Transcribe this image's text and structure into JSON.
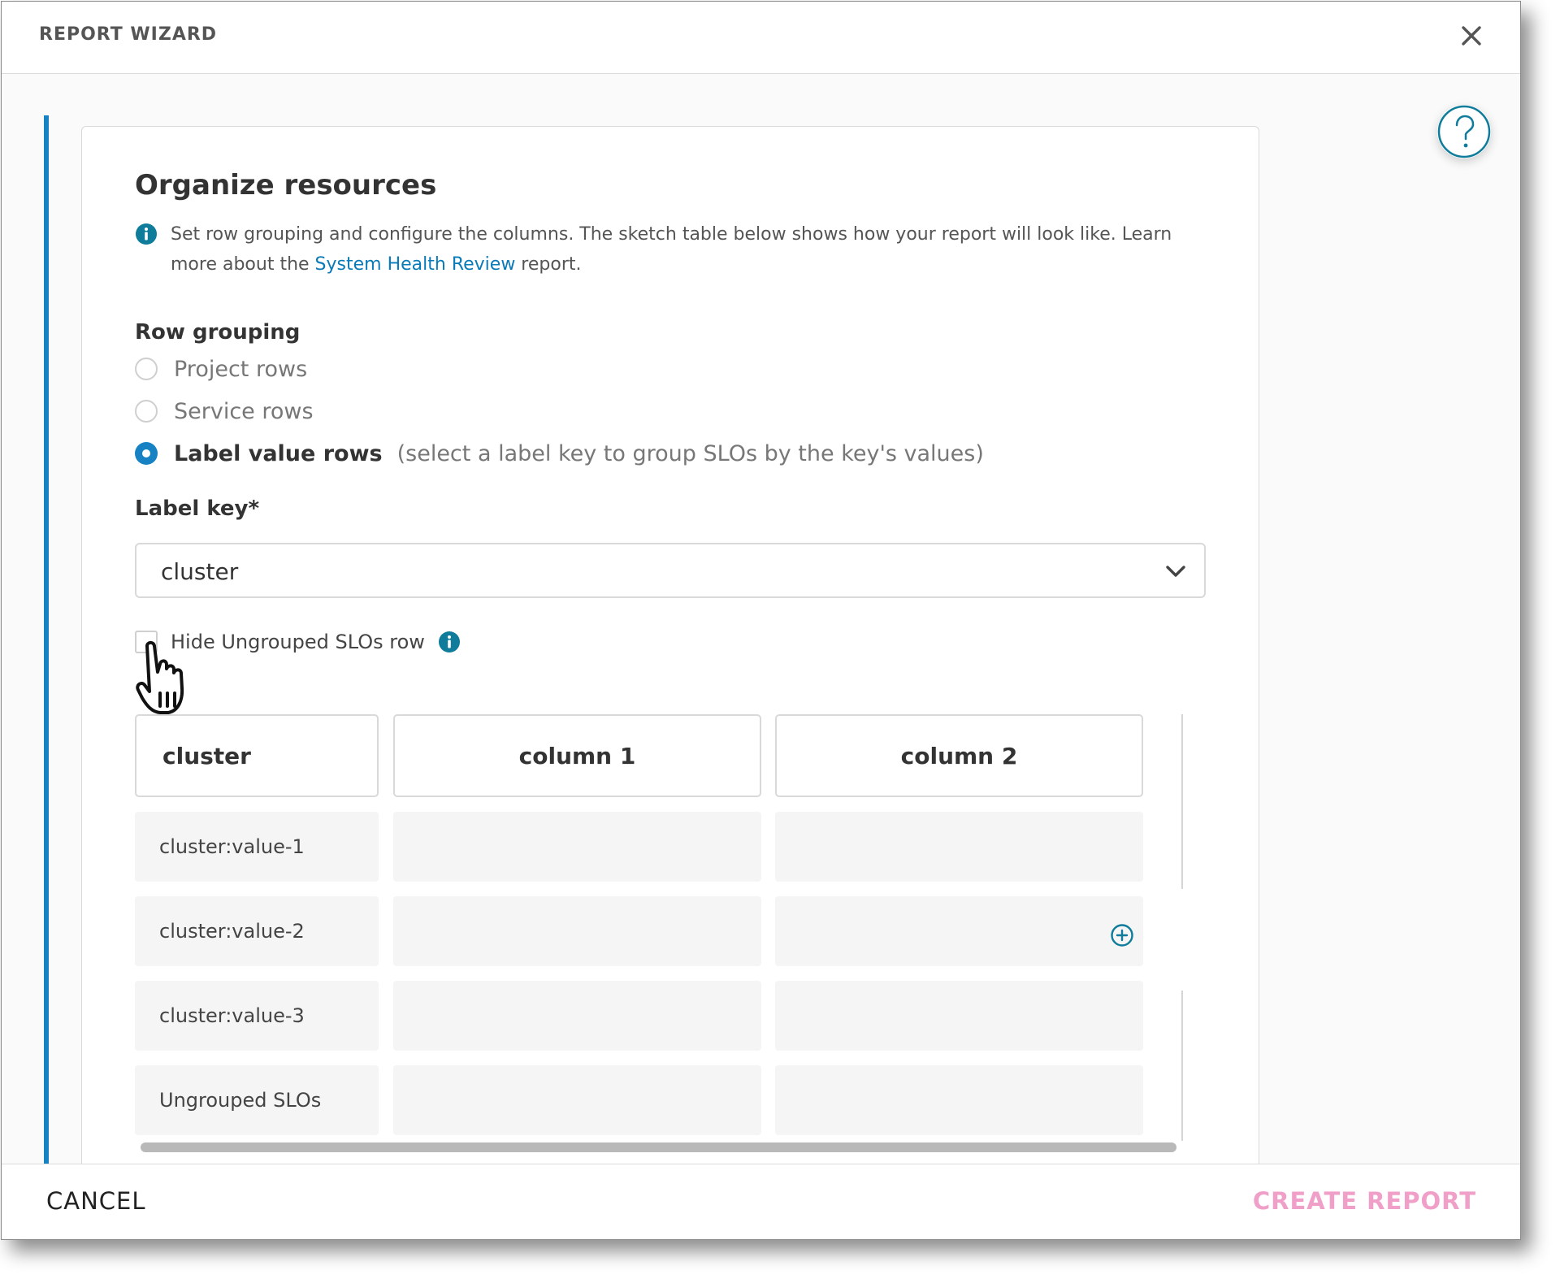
{
  "header": {
    "title": "REPORT WIZARD",
    "close_icon": "close-icon"
  },
  "help": {
    "icon": "question-icon"
  },
  "section": {
    "title": "Organize resources",
    "info": {
      "icon": "info-icon",
      "text_before": "Set row grouping and configure the columns. The sketch table below shows how your report will look like. Learn more about the ",
      "link_text": "System Health Review",
      "text_after": " report."
    }
  },
  "row_grouping": {
    "label": "Row grouping",
    "options": [
      {
        "label": "Project rows",
        "checked": false
      },
      {
        "label": "Service rows",
        "checked": false
      },
      {
        "label": "Label value rows",
        "checked": true,
        "hint": "(select a label key to group SLOs by the key's values)"
      }
    ]
  },
  "label_key": {
    "label": "Label key*",
    "value": "cluster",
    "icon": "chevron-down-icon"
  },
  "hide_ungrouped": {
    "label": "Hide Ungrouped SLOs row",
    "checked": false,
    "icon": "info-icon"
  },
  "sketch_table": {
    "headers": [
      "cluster",
      "column 1",
      "column 2"
    ],
    "rows": [
      "cluster:value-1",
      "cluster:value-2",
      "cluster:value-3",
      "Ungrouped SLOs"
    ],
    "add_column_icon": "plus-circle-icon"
  },
  "footer": {
    "cancel_label": "CANCEL",
    "create_label": "CREATE REPORT"
  },
  "colors": {
    "accent": "#1682c4",
    "link": "#0a7ab8",
    "teal": "#0e7c9a",
    "create_disabled": "#f0a0c8"
  }
}
